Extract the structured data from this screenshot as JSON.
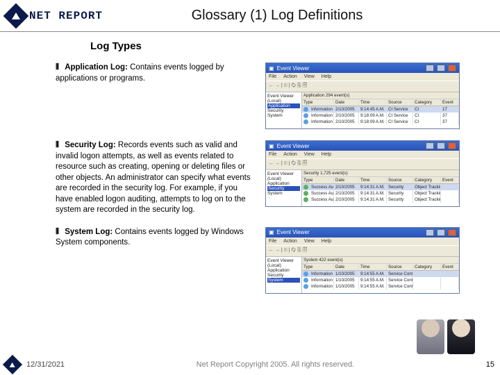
{
  "brand": "NET REPORT",
  "title": "Glossary (1) Log Definitions",
  "subtitle": "Log Types",
  "sections": [
    {
      "label": "Application Log:",
      "body": "Contains events logged by applications or programs.",
      "viewer": {
        "win_title": "Event Viewer",
        "menu": [
          "File",
          "Action",
          "View",
          "Help"
        ],
        "toolbar": "← → | 🗉 | 🗘 🗒 🗐",
        "tree": [
          "Event Viewer (Local)",
          "Application",
          "Security",
          "System"
        ],
        "tree_selected": "Application",
        "list_label": "Application  294 event(s)",
        "columns": [
          "Type",
          "Date",
          "Time",
          "Source",
          "Category",
          "Event"
        ],
        "rows": [
          [
            "Information",
            "2/10/2005",
            "9:14:45 A.M.",
            "CI Service",
            "CI",
            "17"
          ],
          [
            "Information",
            "2/10/2005",
            "9:18:09 A.M.",
            "CI Service",
            "CI",
            "37"
          ],
          [
            "Information",
            "2/10/2005",
            "9:18:09 A.M.",
            "CI Service",
            "CI",
            "37"
          ]
        ],
        "row_icon": "info"
      }
    },
    {
      "label": "Security Log:",
      "body": "Records events such as valid and invalid logon attempts, as well as events related to resource such as creating, opening or deleting files or other objects. An administrator can specify what events are recorded in the security log. For example, if you have enabled logon auditing, attempts to log on to the system are recorded in the security log.",
      "viewer": {
        "win_title": "Event Viewer",
        "menu": [
          "File",
          "Action",
          "View",
          "Help"
        ],
        "toolbar": "← → | 🗉 | 🗘 🗒 🗐",
        "tree": [
          "Event Viewer (Local)",
          "Application",
          "Security",
          "System"
        ],
        "tree_selected": "Security",
        "list_label": "Security  1,725 event(s)",
        "columns": [
          "Type",
          "Date",
          "Time",
          "Source",
          "Category",
          "Event"
        ],
        "rows": [
          [
            "Success Audit",
            "2/10/2005",
            "9:14:31 A.M.",
            "Security",
            "Object Tracking",
            ""
          ],
          [
            "Success Audit",
            "2/10/2005",
            "9:14:31 A.M.",
            "Security",
            "Object Tracking",
            ""
          ],
          [
            "Success Audit",
            "2/10/2005",
            "9:14:31 A.M.",
            "Security",
            "Object Tracking",
            ""
          ]
        ],
        "row_icon": "suc"
      }
    },
    {
      "label": "System Log:",
      "body": "Contains events logged by Windows System components.",
      "viewer": {
        "win_title": "Event Viewer",
        "menu": [
          "File",
          "Action",
          "View",
          "Help"
        ],
        "toolbar": "← → | 🗉 | 🗘 🗒 🗐",
        "tree": [
          "Event Viewer (Local)",
          "Application",
          "Security",
          "System"
        ],
        "tree_selected": "System",
        "list_label": "System  422 event(s)",
        "columns": [
          "Type",
          "Date",
          "Time",
          "Source",
          "Category",
          "Event"
        ],
        "rows": [
          [
            "Information",
            "1/10/2005",
            "9:14:55 A.M.",
            "Service Control Manager",
            "",
            ""
          ],
          [
            "Information",
            "1/10/2005",
            "9:14:55 A.M.",
            "Service Control Manager",
            "",
            ""
          ],
          [
            "Information",
            "1/10/2005",
            "9:14:55 A.M.",
            "Service Control Manager",
            "",
            ""
          ]
        ],
        "row_icon": "info"
      }
    }
  ],
  "footer": {
    "date": "12/31/2021",
    "copyright": "Net Report Copyright 2005. All rights reserved.",
    "page": "15"
  }
}
